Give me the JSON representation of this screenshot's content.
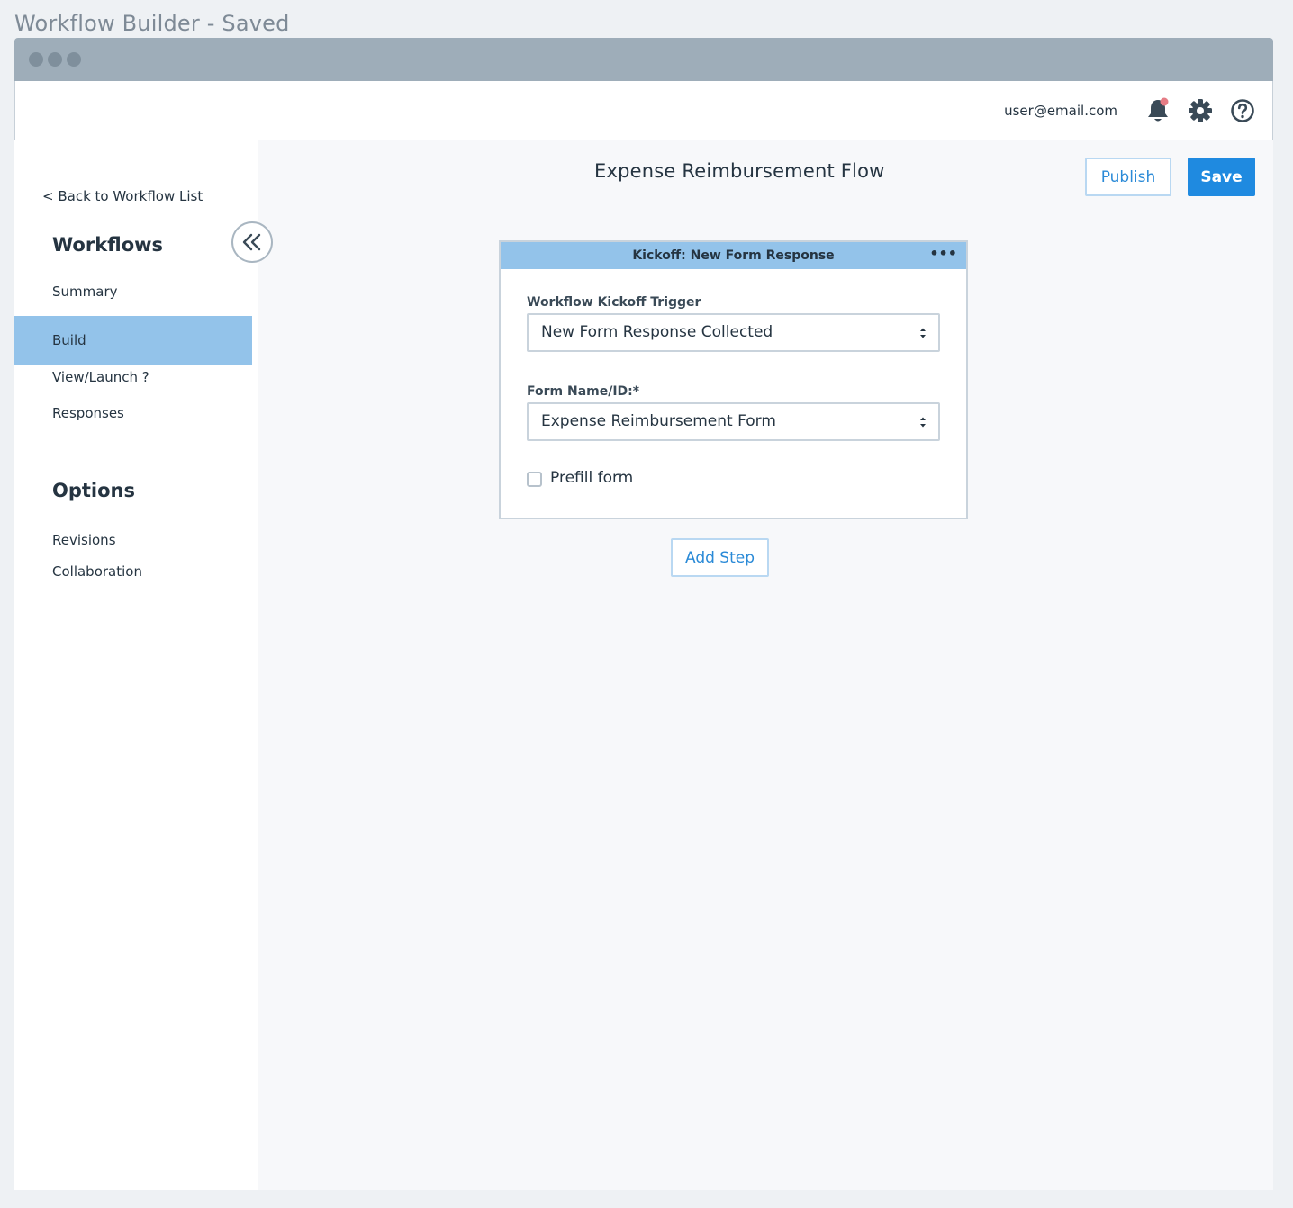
{
  "page": {
    "title": "Workflow Builder - Saved"
  },
  "header": {
    "user_email": "user@email.com",
    "icons": [
      "bell-icon",
      "gear-icon",
      "help-icon"
    ],
    "notification_dot_color": "#e57c85"
  },
  "sidebar": {
    "back_link": "< Back to Workflow List",
    "workflows_heading": "Workflows",
    "items": [
      {
        "label": "Summary",
        "active": false
      },
      {
        "label": "Build",
        "active": true
      },
      {
        "label": "View/Launch ?",
        "active": false
      },
      {
        "label": "Responses",
        "active": false
      }
    ],
    "options_heading": "Options",
    "option_items": [
      {
        "label": "Revisions"
      },
      {
        "label": "Collaboration"
      }
    ]
  },
  "main": {
    "title": "Expense Reimbursement Flow",
    "publish_label": "Publish",
    "save_label": "Save",
    "card": {
      "header": "Kickoff: New Form Response",
      "more_label": "•••",
      "trigger_label": "Workflow Kickoff Trigger",
      "trigger_value": "New Form Response Collected",
      "form_label": "Form Name/ID:*",
      "form_value": "Expense Reimbursement Form",
      "prefill_label": "Prefill form",
      "prefill_checked": false
    },
    "add_step_label": "Add Step"
  },
  "colors": {
    "accent": "#1f8ae0",
    "active_nav": "#93c3ea",
    "titlebar": "#9eadb9"
  }
}
